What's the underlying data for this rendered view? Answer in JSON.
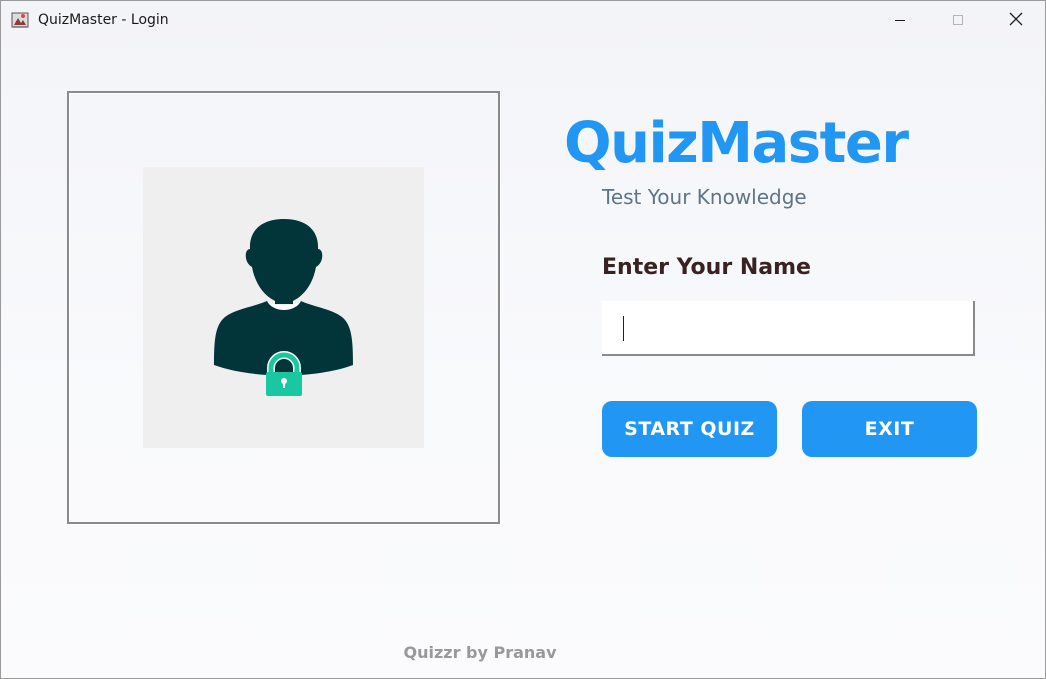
{
  "window": {
    "title": "QuizMaster - Login",
    "icon": "java-app-icon",
    "controls": {
      "minimize": "minimize-icon",
      "maximize": "maximize-icon",
      "close": "close-icon"
    }
  },
  "image_panel": {
    "image": "user-lock-icon"
  },
  "brand": {
    "title": "QuizMaster",
    "subtitle": "Test Your Knowledge"
  },
  "form": {
    "name_label": "Enter Your Name",
    "name_value": "",
    "name_placeholder": ""
  },
  "actions": {
    "start_label": "START QUIZ",
    "exit_label": "EXIT"
  },
  "footer": {
    "text": "Quizzr by Pranav"
  },
  "colors": {
    "accent": "#2196f3",
    "avatar_dark": "#02353a",
    "lock_green": "#19c7a1",
    "subtitle": "#5f7585",
    "label": "#3a2222",
    "footer": "#999999"
  }
}
